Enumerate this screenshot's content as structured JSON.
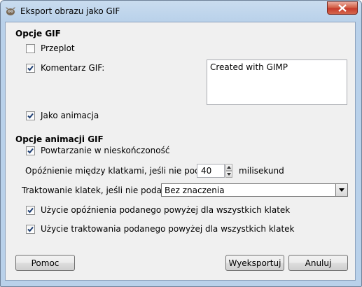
{
  "window": {
    "title": "Eksport obrazu jako GIF"
  },
  "sections": {
    "gif_options": {
      "title": "Opcje GIF",
      "interlace": {
        "label": "Przeplot",
        "checked": false
      },
      "comment": {
        "label": "Komentarz GIF:",
        "checked": true,
        "value": "Created with GIMP"
      },
      "as_animation": {
        "label": "Jako animacja",
        "checked": true
      }
    },
    "animation_options": {
      "title": "Opcje animacji GIF",
      "loop": {
        "label": "Powtarzanie w nieskończoność",
        "checked": true
      },
      "delay": {
        "label": "Opóźnienie między klatkami, jeśli nie podano:",
        "value": "40",
        "unit": "milisekund"
      },
      "disposal": {
        "label": "Traktowanie klatek, jeśli nie podano:",
        "selected": "Bez znaczenia"
      },
      "use_delay": {
        "label": "Użycie opóźnienia podanego powyżej dla wszystkich klatek",
        "checked": true
      },
      "use_disposal": {
        "label": "Użycie traktowania podanego powyżej dla wszystkich klatek",
        "checked": true
      }
    }
  },
  "buttons": {
    "help": "Pomoc",
    "export": "Wyeksportuj",
    "cancel": "Anuluj"
  },
  "icons": {
    "app": "gimp-icon",
    "close": "close-icon",
    "check": "checkmark-icon"
  },
  "colors": {
    "close_button": "#c6392a",
    "title_bg": "#b9d1ea",
    "dialog_bg": "#f0f0f0"
  }
}
